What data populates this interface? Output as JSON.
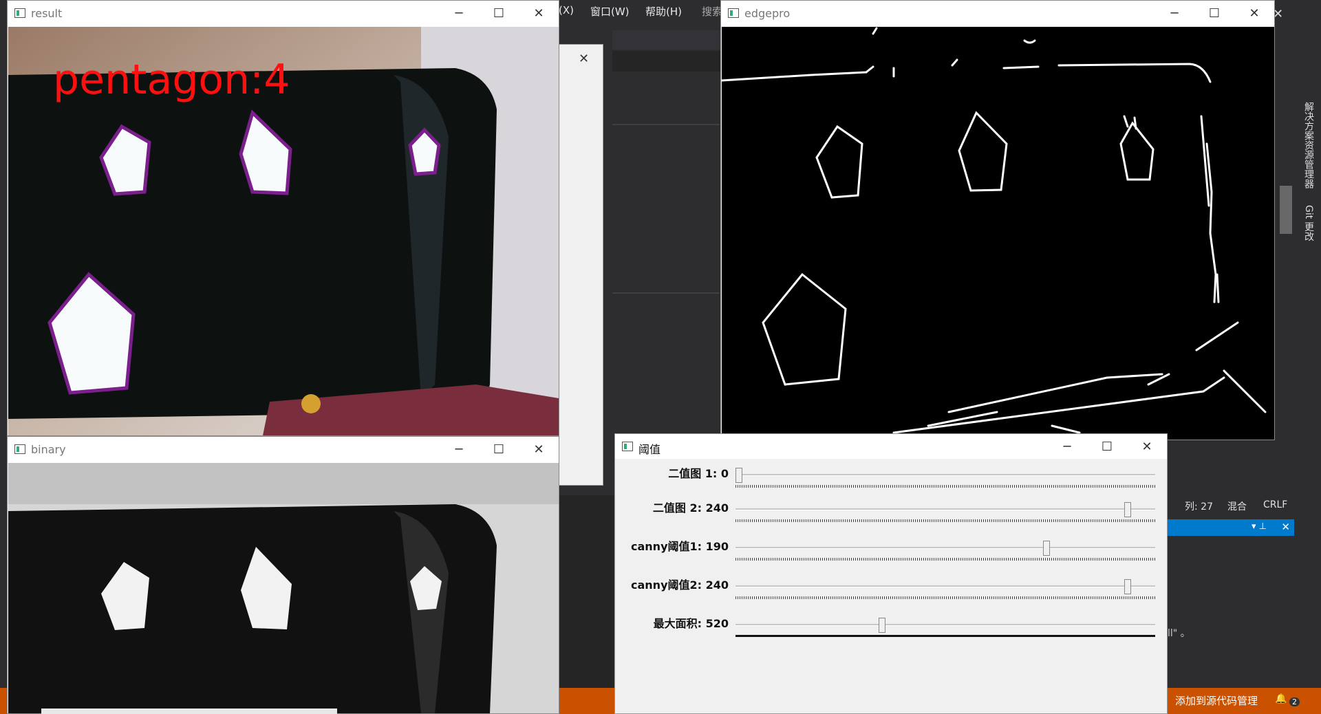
{
  "ide": {
    "menu": [
      "(X)",
      "窗口(W)",
      "帮助(H)",
      "搜索"
    ],
    "status": {
      "col": "列: 27",
      "mode": "混合",
      "eol": "CRLF"
    },
    "source_control": "添加到源代码管理",
    "notifications": "2",
    "side_tabs": [
      "解决方案资源管理器",
      "Git 更改"
    ],
    "snippet": "ll\" 。"
  },
  "result_window": {
    "title": "result",
    "overlay_text": "pentagon:4"
  },
  "binary_window": {
    "title": "binary"
  },
  "edgepro_window": {
    "title": "edgepro"
  },
  "trackbar_window": {
    "title": "阈值",
    "trackbars": [
      {
        "label": "二值图 1: 0",
        "value": 0,
        "max": 255
      },
      {
        "label": "二值图 2: 240",
        "value": 240,
        "max": 255
      },
      {
        "label": "canny阈值1: 190",
        "value": 190,
        "max": 255
      },
      {
        "label": "canny阈值2: 240",
        "value": 240,
        "max": 255
      },
      {
        "label": "最大面积: 520",
        "value": 520,
        "max": 1500
      }
    ]
  },
  "window_controls": {
    "minimize": "─",
    "maximize": "☐",
    "close": "✕"
  },
  "colors": {
    "overlay_text": "#ff1010",
    "contour": "#7a1f8c",
    "ide_accent": "#007acc",
    "status_orange": "#ca5100"
  }
}
